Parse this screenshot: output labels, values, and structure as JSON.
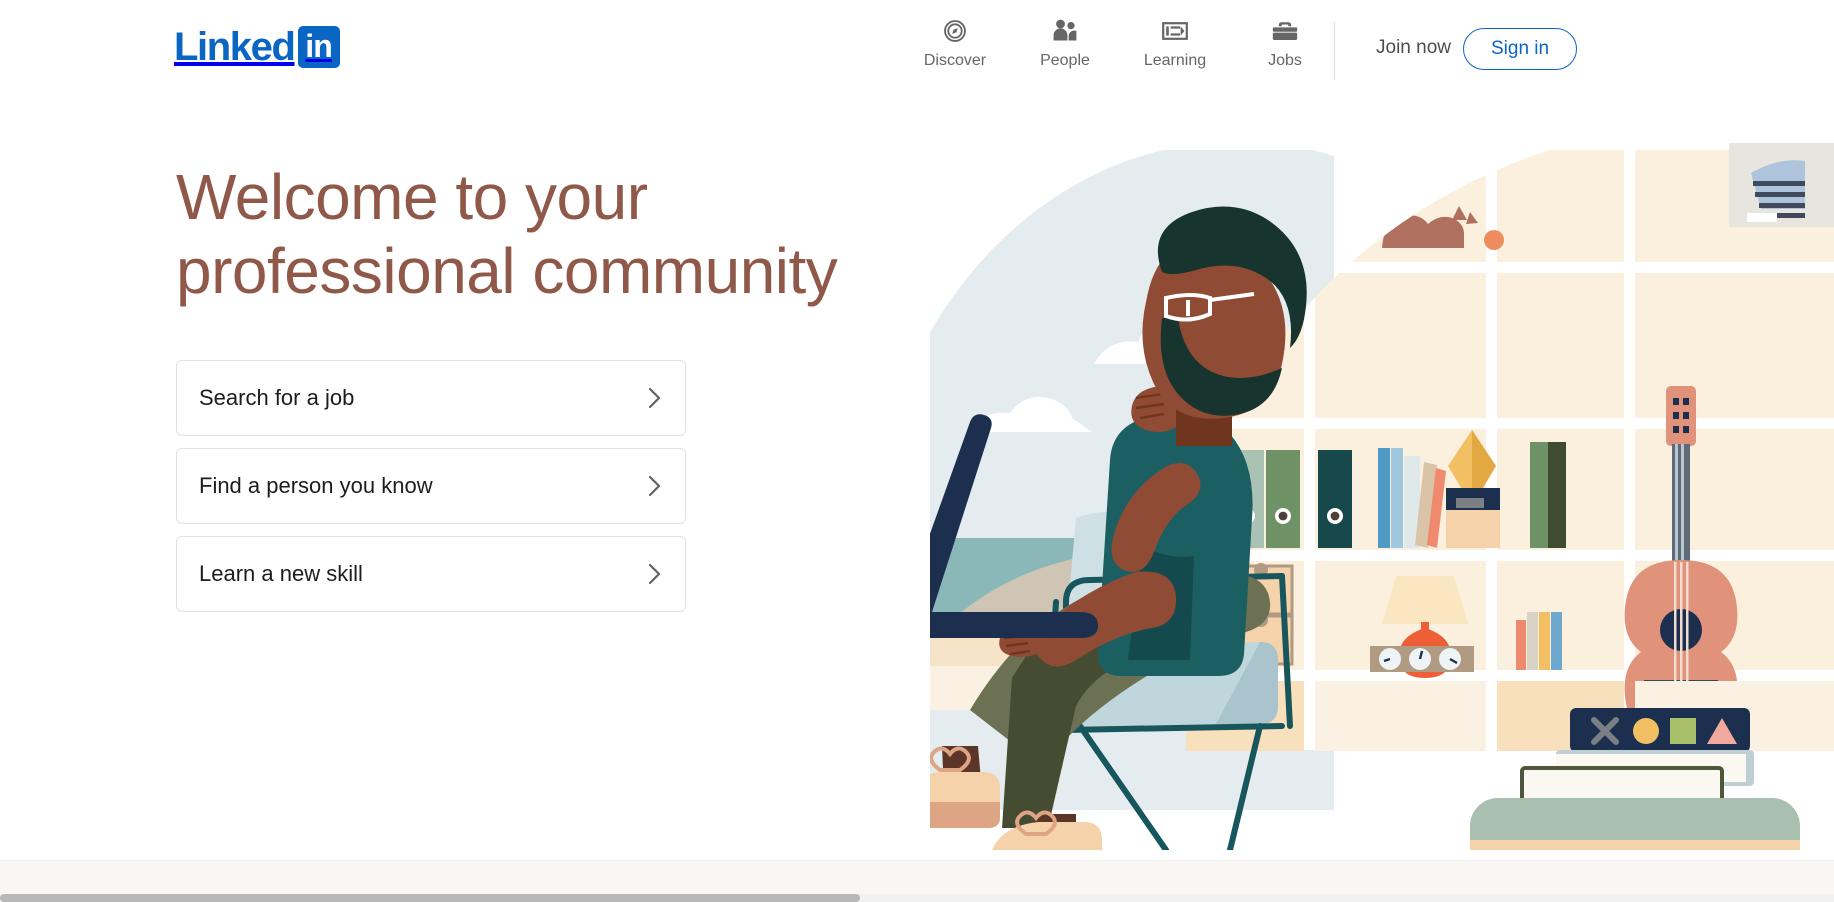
{
  "brand": {
    "name_word": "Linked",
    "name_badge": "in",
    "blue": "#0a66c2"
  },
  "header": {
    "nav": [
      {
        "label": "Discover",
        "icon": "compass-icon"
      },
      {
        "label": "People",
        "icon": "people-icon"
      },
      {
        "label": "Learning",
        "icon": "learning-video-icon"
      },
      {
        "label": "Jobs",
        "icon": "briefcase-icon"
      }
    ],
    "join_now_label": "Join now",
    "sign_in_label": "Sign in"
  },
  "hero": {
    "headline": "Welcome to your\nprofessional community",
    "headline_color": "#8f5849",
    "cta_cards": [
      {
        "label": "Search for a job",
        "icon": "chevron-right-icon"
      },
      {
        "label": "Find a person you know",
        "icon": "chevron-right-icon"
      },
      {
        "label": "Learn a new skill",
        "icon": "chevron-right-icon"
      }
    ]
  },
  "illustration": {
    "name": "person-reading-at-bookshelf-illustration",
    "palette": {
      "sky_circle": "#e4ecef",
      "cloud": "#ffffff",
      "water": "#85b4b4",
      "sand": "#f6e4c8",
      "dune": "#cfc5b4",
      "shelf_bg": "#fbf0dd",
      "shelf_bg_alt": "#f9e9d0",
      "skin": "#8f4b33",
      "hair": "#17342f",
      "shirt": "#1c5f63",
      "pants": "#6b7152",
      "pants_dark": "#454c32",
      "shoe": "#f6d2ab",
      "shoe_sole": "#dda583",
      "chair_seat": "#bfd6dc",
      "chair_frame": "#18565d",
      "laptop": "#1d2f4e",
      "guitar": "#e0927b",
      "cat": "#b0705f",
      "lamp_base": "#ee5f37",
      "lamp_shade": "#fae7c2",
      "vase": "#f2c062",
      "globe_land": "#6c8a61",
      "globe_sea": "#dbe9f5"
    }
  },
  "art_card": {
    "name": "framed-artwork",
    "background": "#e8e5df"
  }
}
